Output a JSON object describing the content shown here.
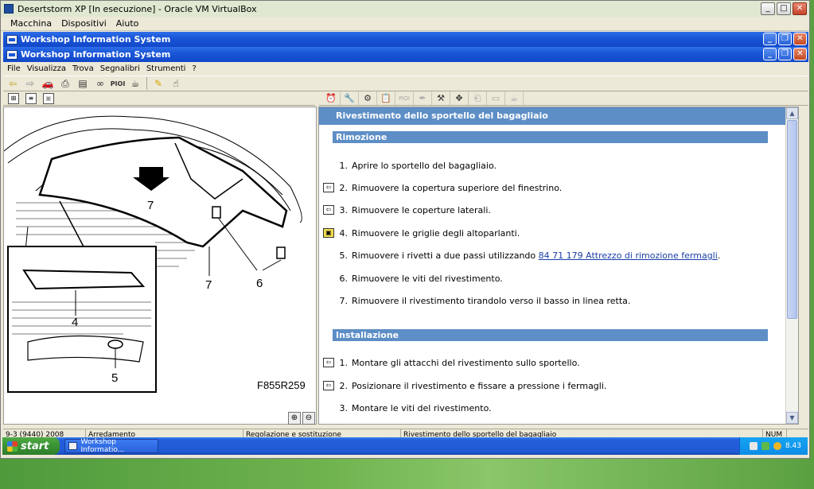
{
  "vbox": {
    "title": "Desertstorm XP [In esecuzione] - Oracle VM VirtualBox",
    "menu": [
      "Macchina",
      "Dispositivi",
      "Aiuto"
    ]
  },
  "outer_window": {
    "title": "Workshop Information System"
  },
  "inner_window": {
    "title": "Workshop Information System"
  },
  "app_menu": [
    "File",
    "Visualizza",
    "Trova",
    "Segnalibri",
    "Strumenti",
    "?"
  ],
  "toolbar": {
    "pio_label": "PIOI",
    "icons": [
      "back-arrow-icon",
      "forward-arrow-icon",
      "car-icon",
      "print-icon",
      "document-icon",
      "binoculars-icon",
      "pio-icon",
      "mug-icon",
      "pencil-icon",
      "hand-pointer-icon"
    ]
  },
  "right_toolbar": {
    "pio_label": "PIOI"
  },
  "diagram": {
    "code": "F855R259",
    "callouts": [
      "7",
      "7",
      "6",
      "4",
      "5"
    ]
  },
  "doc": {
    "title": "Rivestimento dello sportello del bagagliaio",
    "removal": {
      "heading": "Rimozione",
      "steps": [
        {
          "num": "1.",
          "text": "Aprire lo sportello del bagagliaio.",
          "ref": ""
        },
        {
          "num": "2.",
          "text": "Rimuovere la copertura superiore del finestrino.",
          "ref": "arrow"
        },
        {
          "num": "3.",
          "text": "Rimuovere le coperture laterali.",
          "ref": "arrow"
        },
        {
          "num": "4.",
          "text": "Rimuovere le griglie degli altoparlanti.",
          "ref": "yellow"
        },
        {
          "num": "5.",
          "text": "Rimuovere i rivetti a due passi utilizzando",
          "link": "84 71 179 Attrezzo di rimozione fermagli",
          "ref": ""
        },
        {
          "num": "6.",
          "text": "Rimuovere le viti del rivestimento.",
          "ref": ""
        },
        {
          "num": "7.",
          "text": "Rimuovere il rivestimento tirandolo verso il basso in linea retta.",
          "ref": ""
        }
      ]
    },
    "install": {
      "heading": "Installazione",
      "steps": [
        {
          "num": "1.",
          "text": "Montare gli attacchi del rivestimento sullo sportello.",
          "ref": "arrow"
        },
        {
          "num": "2.",
          "text": "Posizionare il rivestimento e fissare a pressione i fermagli.",
          "ref": "arrow"
        },
        {
          "num": "3.",
          "text": "Montare le viti del rivestimento.",
          "ref": ""
        }
      ]
    }
  },
  "status": {
    "model": "9-3 (9440) 2008",
    "category": "Arredamento",
    "operation": "Regolazione e sostituzione",
    "topic": "Rivestimento dello sportello del bagagliaio",
    "num": "NUM"
  },
  "taskbar": {
    "start": "start",
    "task": "Workshop Informatio...",
    "clock": "8.43"
  }
}
